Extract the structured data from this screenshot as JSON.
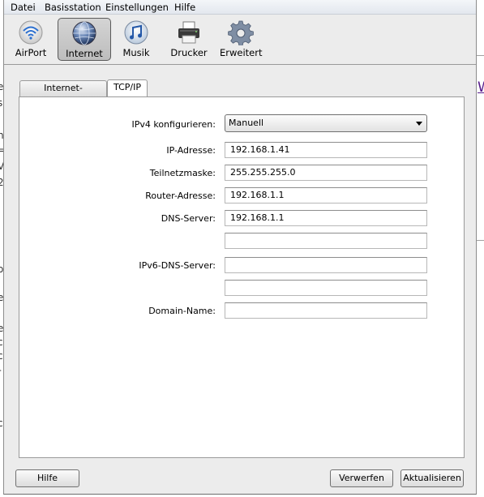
{
  "menu": [
    "Datei",
    "Basisstation",
    "Einstellungen",
    "Hilfe"
  ],
  "toolbar": {
    "items": [
      {
        "label": "AirPort",
        "icon": "airport-wifi-icon"
      },
      {
        "label": "Internet",
        "icon": "globe-icon"
      },
      {
        "label": "Musik",
        "icon": "music-icon"
      },
      {
        "label": "Drucker",
        "icon": "printer-icon"
      },
      {
        "label": "Erweitert",
        "icon": "gear-icon"
      }
    ],
    "selected": "Internet"
  },
  "tabs": [
    {
      "label": "Internet-Verbindung",
      "active": false
    },
    {
      "label": "TCP/IP",
      "active": true
    }
  ],
  "form": {
    "ipv4_config": {
      "label": "IPv4 konfigurieren:",
      "value": "Manuell"
    },
    "ip_address": {
      "label": "IP-Adresse:",
      "value": "192.168.1.41"
    },
    "subnet_mask": {
      "label": "Teilnetzmaske:",
      "value": "255.255.255.0"
    },
    "router_address": {
      "label": "Router-Adresse:",
      "value": "192.168.1.1"
    },
    "dns_server": {
      "label": "DNS-Server:",
      "value": "192.168.1.1",
      "value2": ""
    },
    "ipv6_dns_server": {
      "label": "IPv6-DNS-Server:",
      "value": "",
      "value2": ""
    },
    "domain_name": {
      "label": "Domain-Name:",
      "value": ""
    }
  },
  "buttons": {
    "help": "Hilfe",
    "discard": "Verwerfen",
    "update": "Aktualisieren"
  },
  "background": {
    "link_char": "W"
  },
  "colors": {
    "window_bg": "#ececec",
    "selected_toolbar_bg": "#c8c8c8",
    "background_link": "#551a8b"
  }
}
